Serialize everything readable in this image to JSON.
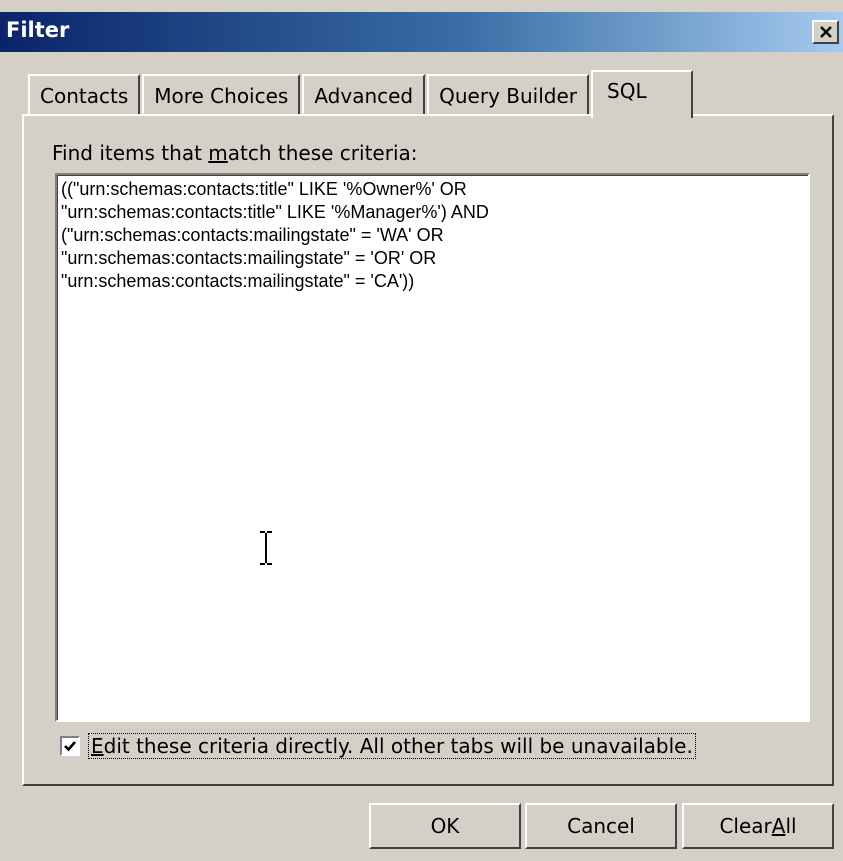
{
  "window": {
    "title": "Filter",
    "close_glyph": "✕"
  },
  "tabs": [
    {
      "label": "Contacts",
      "active": false
    },
    {
      "label": "More Choices",
      "active": false
    },
    {
      "label": "Advanced",
      "active": false
    },
    {
      "label": "Query Builder",
      "active": false
    },
    {
      "label": "SQL",
      "active": true
    }
  ],
  "sql_panel": {
    "find_label_pre": "Find items that ",
    "find_label_mnemonic": "m",
    "find_label_post": "atch these criteria:",
    "criteria_text": "((\"urn:schemas:contacts:title\" LIKE '%Owner%' OR\n\"urn:schemas:contacts:title\" LIKE '%Manager%') AND\n(\"urn:schemas:contacts:mailingstate\" = 'WA' OR\n\"urn:schemas:contacts:mailingstate\" = 'OR' OR\n\"urn:schemas:contacts:mailingstate\" = 'CA'))",
    "edit_directly_checked": true,
    "edit_directly_mnemonic": "E",
    "edit_directly_label": "dit these criteria directly.  All other tabs will be unavailable."
  },
  "buttons": {
    "ok": "OK",
    "cancel": "Cancel",
    "clear_all_pre": "Clear ",
    "clear_all_mnemonic": "A",
    "clear_all_post": "ll"
  },
  "colors": {
    "dialog_face": "#d4d0c8",
    "title_gradient_start": "#0a246a",
    "title_gradient_end": "#a6caf0",
    "title_text": "#ffffff"
  },
  "icons": {
    "close": "close-icon",
    "check": "checkmark-icon",
    "cursor": "ibeam-cursor-icon"
  }
}
